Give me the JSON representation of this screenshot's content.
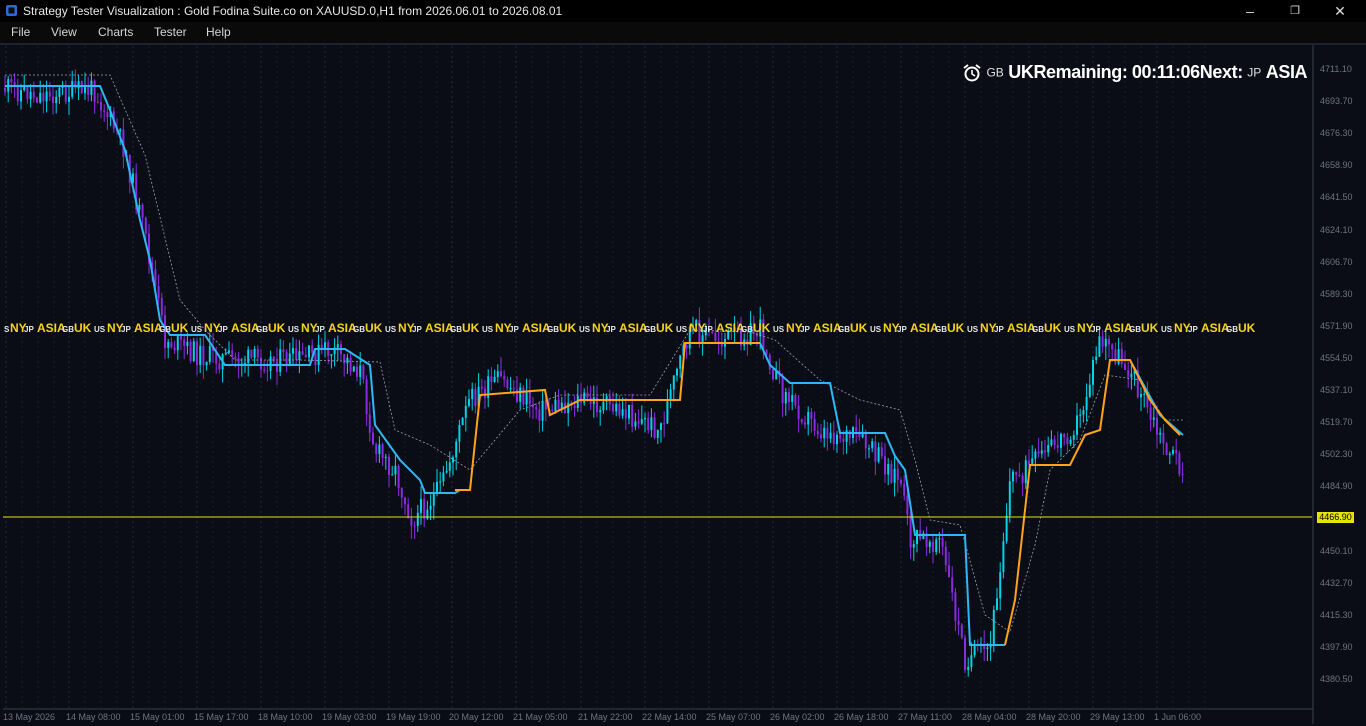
{
  "window": {
    "title": "Strategy Tester Visualization : Gold Fodina Suite.co on XAUUSD.0,H1 from 2026.06.01 to 2026.08.01"
  },
  "menu": [
    "File",
    "View",
    "Charts",
    "Tester",
    "Help"
  ],
  "hud": {
    "flag1": "GB",
    "session1": "UK",
    "remaining_label": "Remaining:",
    "time": "00:11:06",
    "next_label": "Next:",
    "flag2": "JP",
    "session2": "ASIA"
  },
  "session_band": [
    "S",
    "NY",
    "JP",
    "ASIA",
    "GB",
    "UK",
    "US",
    "NY",
    "JP",
    "ASIA",
    "GB",
    "UK",
    "US",
    "NY",
    "JP",
    "ASIA",
    "GB",
    "UK",
    "US",
    "NY",
    "JP",
    "ASIA",
    "GB",
    "UK",
    "US",
    "NY",
    "JP",
    "ASIA",
    "GB",
    "UK",
    "US",
    "NY",
    "JP",
    "ASIA",
    "GB",
    "UK",
    "US",
    "NY",
    "JP",
    "ASIA",
    "GB",
    "UK",
    "US",
    "NY",
    "JP",
    "ASIA",
    "GB",
    "UK",
    "US",
    "NY",
    "JP",
    "ASIA",
    "GB",
    "UK",
    "US",
    "NY",
    "JP",
    "ASIA",
    "GB",
    "UK",
    "US",
    "NY",
    "JP",
    "ASIA",
    "GB",
    "UK",
    "US",
    "NY",
    "JP",
    "ASIA",
    "GB",
    "UK",
    "US",
    "NY",
    "JP",
    "ASIA",
    "GB",
    "UK"
  ],
  "price_axis": [
    "4711.10",
    "4693.70",
    "4676.30",
    "4658.90",
    "4641.50",
    "4624.10",
    "4606.70",
    "4589.30",
    "4571.90",
    "4554.50",
    "4537.10",
    "4519.70",
    "4502.30",
    "4484.90",
    "4450.10",
    "4432.70",
    "4415.30",
    "4397.90",
    "4380.50"
  ],
  "current_price": "4466.90",
  "time_axis": [
    "13 May 2026",
    "14 May 08:00",
    "15 May 01:00",
    "15 May 17:00",
    "18 May 10:00",
    "19 May 03:00",
    "19 May 19:00",
    "20 May 12:00",
    "21 May 05:00",
    "21 May 22:00",
    "22 May 14:00",
    "25 May 07:00",
    "26 May 02:00",
    "26 May 18:00",
    "27 May 11:00",
    "28 May 04:00",
    "28 May 20:00",
    "29 May 13:00",
    "1 Jun 06:00"
  ],
  "colors": {
    "bull": "#00d4e8",
    "bear": "#8a2be2",
    "trend_up": "#2db7f5",
    "trend_alt": "#ffa31a",
    "price_line": "#e5e500",
    "session_text": "#f4d31c"
  }
}
